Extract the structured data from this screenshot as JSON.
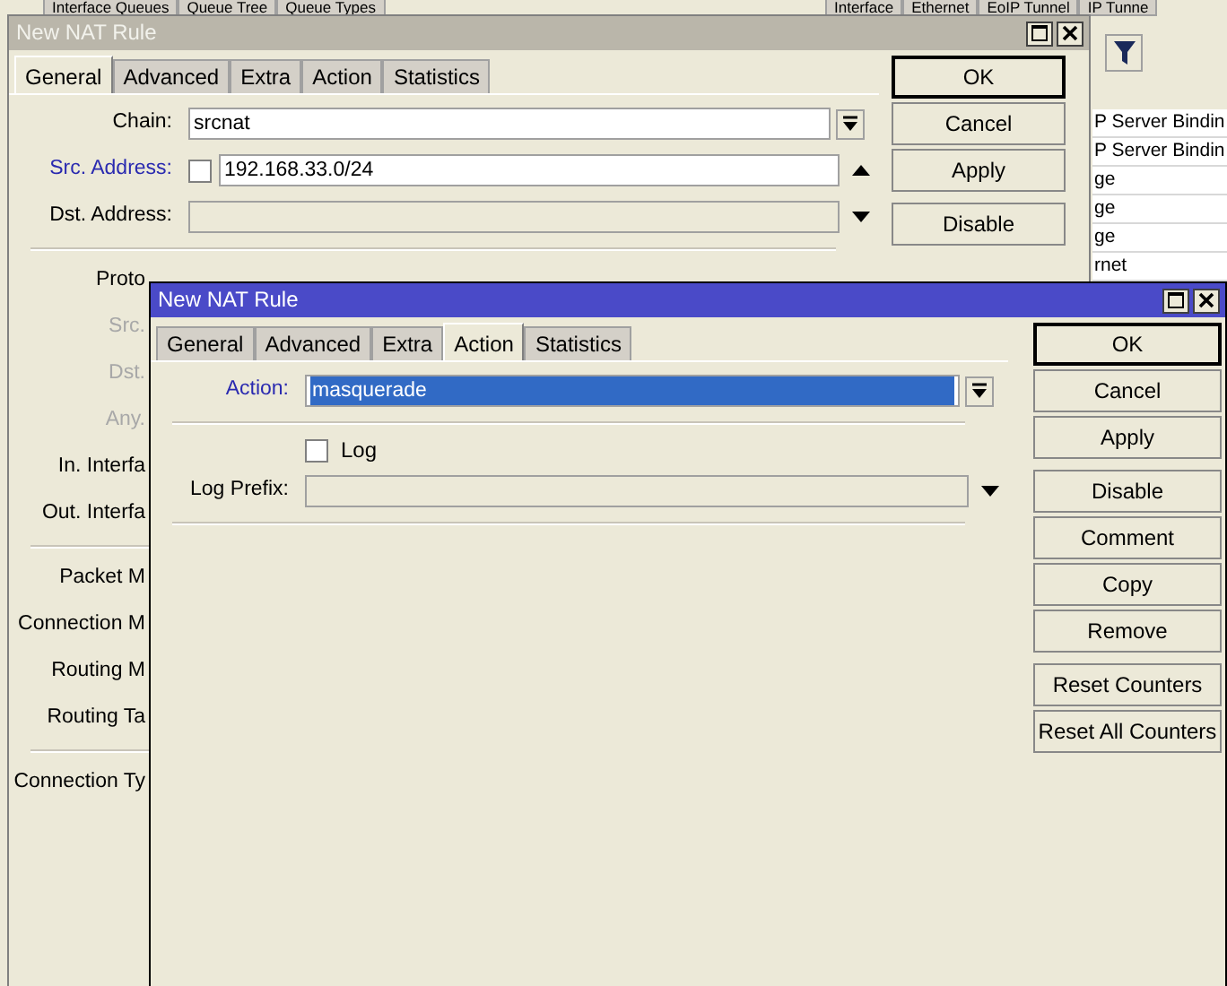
{
  "background_app": {
    "top_tabs": [
      "Interface Queues",
      "Queue Tree",
      "Queue Types"
    ],
    "right_tabs": [
      "Interface",
      "Ethernet",
      "EoIP Tunnel",
      "IP Tunne"
    ],
    "list_rows": [
      "P Server Bindin",
      "P Server Bindin",
      "ge",
      "ge",
      "ge",
      "rnet"
    ]
  },
  "windows": [
    {
      "title": "New NAT Rule",
      "active": false,
      "tabs": [
        {
          "label": "General",
          "selected": true
        },
        {
          "label": "Advanced",
          "selected": false
        },
        {
          "label": "Extra",
          "selected": false
        },
        {
          "label": "Action",
          "selected": false
        },
        {
          "label": "Statistics",
          "selected": false
        }
      ],
      "fields": [
        {
          "kind": "select",
          "label": "Chain:",
          "modified": false,
          "value": "srcnat",
          "highlighted": false
        },
        {
          "kind": "address",
          "label": "Src. Address:",
          "modified": true,
          "checked": false,
          "value": "192.168.33.0/24",
          "expanded": true
        },
        {
          "kind": "input",
          "label": "Dst. Address:",
          "modified": false,
          "disabled": true,
          "expanded": false
        },
        {
          "kind": "separator"
        },
        {
          "kind": "label",
          "label": "Proto",
          "disabled": false
        },
        {
          "kind": "label",
          "label": "Src.",
          "disabled": true
        },
        {
          "kind": "label",
          "label": "Dst.",
          "disabled": true
        },
        {
          "kind": "label",
          "label": "Any.",
          "disabled": true
        },
        {
          "kind": "label",
          "label": "In. Interfa",
          "disabled": false
        },
        {
          "kind": "label",
          "label": "Out. Interfa",
          "disabled": false
        },
        {
          "kind": "separator"
        },
        {
          "kind": "label",
          "label": "Packet M",
          "disabled": false
        },
        {
          "kind": "label",
          "label": "Connection M",
          "disabled": false
        },
        {
          "kind": "label",
          "label": "Routing M",
          "disabled": false
        },
        {
          "kind": "label",
          "label": "Routing Ta",
          "disabled": false
        },
        {
          "kind": "separator"
        },
        {
          "kind": "label",
          "label": "Connection Ty",
          "disabled": false
        }
      ],
      "button_groups": [
        [
          "OK",
          "Cancel",
          "Apply"
        ],
        [
          "Disable"
        ]
      ]
    },
    {
      "title": "New NAT Rule",
      "active": true,
      "tabs": [
        {
          "label": "General",
          "selected": false
        },
        {
          "label": "Advanced",
          "selected": false
        },
        {
          "label": "Extra",
          "selected": false
        },
        {
          "label": "Action",
          "selected": true
        },
        {
          "label": "Statistics",
          "selected": false
        }
      ],
      "fields": [
        {
          "kind": "select",
          "label": "Action:",
          "modified": true,
          "value": "masquerade",
          "highlighted": true
        },
        {
          "kind": "separator"
        },
        {
          "kind": "checkbox",
          "label": "Log",
          "checked": false
        },
        {
          "kind": "input",
          "label": "Log Prefix:",
          "modified": false,
          "disabled": true,
          "expanded": false
        },
        {
          "kind": "separator"
        }
      ],
      "button_groups": [
        [
          "OK",
          "Cancel",
          "Apply"
        ],
        [
          "Disable",
          "Comment",
          "Copy",
          "Remove"
        ],
        [
          "Reset Counters",
          "Reset All Counters"
        ]
      ]
    }
  ]
}
